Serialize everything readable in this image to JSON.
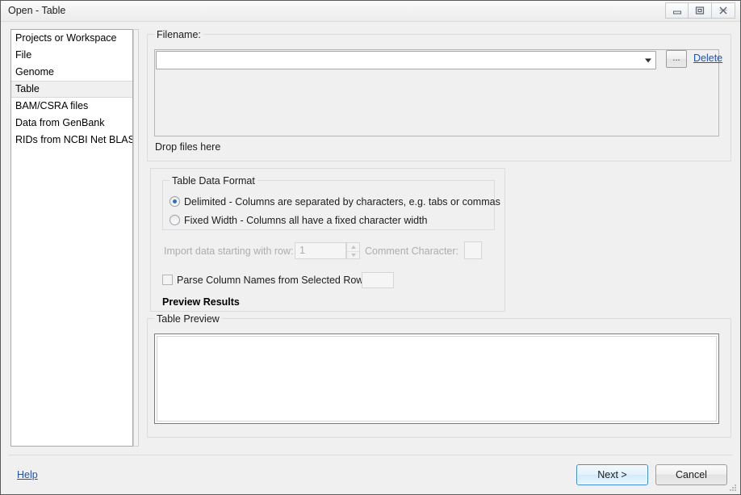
{
  "window": {
    "title": "Open - Table",
    "controls": [
      {
        "name": "minimize-button",
        "glyph": "minimize"
      },
      {
        "name": "restore-button",
        "glyph": "restore"
      },
      {
        "name": "close-button",
        "glyph": "close"
      }
    ]
  },
  "sidebar": {
    "items": [
      {
        "label": "Projects or Workspace",
        "selected": false
      },
      {
        "label": "File",
        "selected": false
      },
      {
        "label": "Genome",
        "selected": false
      },
      {
        "label": "Table",
        "selected": true
      },
      {
        "label": "BAM/CSRA files",
        "selected": false
      },
      {
        "label": "Data from GenBank",
        "selected": false
      },
      {
        "label": "RIDs from NCBI Net BLAST",
        "selected": false
      }
    ]
  },
  "filename": {
    "group_title": "Filename:",
    "combo_value": "",
    "combo_placeholder": "",
    "browse_label": "...",
    "delete_label": "Delete",
    "drop_hint": "Drop files here"
  },
  "format": {
    "group_title": "Table Data Format",
    "options": [
      {
        "label": "Delimited - Columns are separated by characters, e.g. tabs or commas",
        "selected": true
      },
      {
        "label": "Fixed Width - Columns all have a fixed character width",
        "selected": false
      }
    ],
    "import_row_label": "Import data starting with row:",
    "import_row_value": "1",
    "import_row_disabled": true,
    "comment_char_label": "Comment Character:",
    "comment_char_value": "",
    "comment_char_disabled": true,
    "parse_names_label": "Parse Column Names from Selected Row:",
    "parse_names_checked": false,
    "parse_names_value": "",
    "preview_results_label": "Preview Results"
  },
  "preview": {
    "group_title": "Table Preview",
    "content": ""
  },
  "footer": {
    "help_label": "Help",
    "next_label": "Next >",
    "cancel_label": "Cancel"
  },
  "colors": {
    "accent_link": "#1a53c4",
    "focus_border": "#3c8ddc",
    "radio_dot": "#2b72c4",
    "window_bg": "#f0f0f0",
    "disabled_text": "#adadad"
  }
}
